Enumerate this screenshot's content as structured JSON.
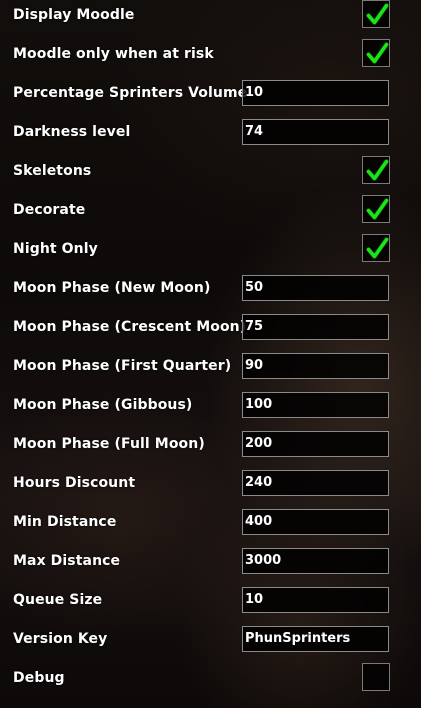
{
  "settings": [
    {
      "label": "Display Moodle",
      "type": "checkbox",
      "checked": true
    },
    {
      "label": "Moodle only when at risk",
      "type": "checkbox",
      "checked": true
    },
    {
      "label": "Percentage Sprinters Volume",
      "type": "text",
      "value": "10"
    },
    {
      "label": "Darkness level",
      "type": "text",
      "value": "74"
    },
    {
      "label": "Skeletons",
      "type": "checkbox",
      "checked": true
    },
    {
      "label": "Decorate",
      "type": "checkbox",
      "checked": true
    },
    {
      "label": "Night Only",
      "type": "checkbox",
      "checked": true
    },
    {
      "label": "Moon Phase (New Moon)",
      "type": "text",
      "value": "50"
    },
    {
      "label": "Moon Phase (Crescent Moon)",
      "type": "text",
      "value": "75"
    },
    {
      "label": "Moon Phase (First Quarter)",
      "type": "text",
      "value": "90"
    },
    {
      "label": "Moon Phase (Gibbous)",
      "type": "text",
      "value": "100"
    },
    {
      "label": "Moon Phase (Full Moon)",
      "type": "text",
      "value": "200"
    },
    {
      "label": "Hours Discount",
      "type": "text",
      "value": "240"
    },
    {
      "label": "Min Distance",
      "type": "text",
      "value": "400"
    },
    {
      "label": "Max Distance",
      "type": "text",
      "value": "3000"
    },
    {
      "label": "Queue Size",
      "type": "text",
      "value": "10"
    },
    {
      "label": "Version Key",
      "type": "text",
      "value": "PhunSprinters"
    },
    {
      "label": "Debug",
      "type": "checkbox",
      "checked": false
    }
  ],
  "colors": {
    "check_mark": "#19e619",
    "check_mark_shadow": "#0a5a0a",
    "label_text": "#ffffff",
    "input_border": "#8a8a8a"
  },
  "icons": {
    "checked": "checkmark-icon"
  }
}
